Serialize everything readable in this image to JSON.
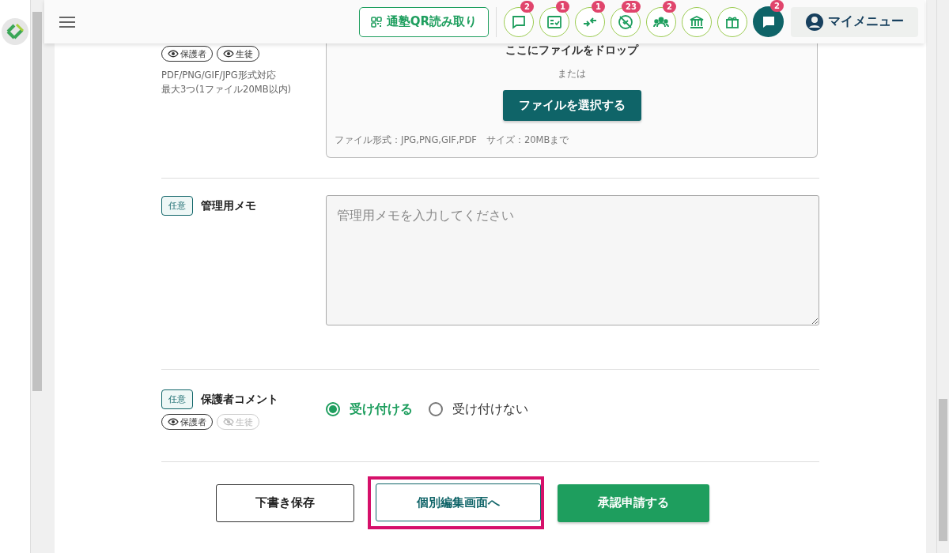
{
  "header": {
    "qr_button": "通塾QR読み取り",
    "icon_buttons": [
      {
        "kind": "chat",
        "badge": "2"
      },
      {
        "kind": "checklist",
        "badge": "1"
      },
      {
        "kind": "arrows",
        "badge": "1"
      },
      {
        "kind": "blocked",
        "badge": "23"
      },
      {
        "kind": "group",
        "badge": "2"
      },
      {
        "kind": "bank"
      },
      {
        "kind": "gift"
      }
    ],
    "chat_button": {
      "badge": "2"
    },
    "my_menu": "マイメニュー"
  },
  "upload": {
    "visibility": [
      {
        "label": "保護者",
        "visible": true
      },
      {
        "label": "生徒",
        "visible": true
      }
    ],
    "notes": [
      "PDF/PNG/GIF/JPG形式対応",
      "最大3つ(1ファイル20MB以内)"
    ],
    "drop_text": "ここにファイルをドロップ",
    "or_text": "または",
    "select_button": "ファイルを選択する",
    "footnote": "ファイル形式：JPG,PNG,GIF,PDF　サイズ：20MBまで"
  },
  "memo": {
    "badge": "任意",
    "label": "管理用メモ",
    "placeholder": "管理用メモを入力してください"
  },
  "comment": {
    "badge": "任意",
    "label": "保護者コメント",
    "visibility": [
      {
        "label": "保護者",
        "visible": true
      },
      {
        "label": "生徒",
        "visible": false
      }
    ],
    "options": [
      {
        "label": "受け付ける",
        "selected": true
      },
      {
        "label": "受け付けない",
        "selected": false
      }
    ]
  },
  "actions": [
    {
      "label": "下書き保存",
      "kind": "outline",
      "highlighted": false
    },
    {
      "label": "個別編集画面へ",
      "kind": "outline",
      "highlighted": true
    },
    {
      "label": "承認申請する",
      "kind": "primary",
      "highlighted": false
    }
  ]
}
